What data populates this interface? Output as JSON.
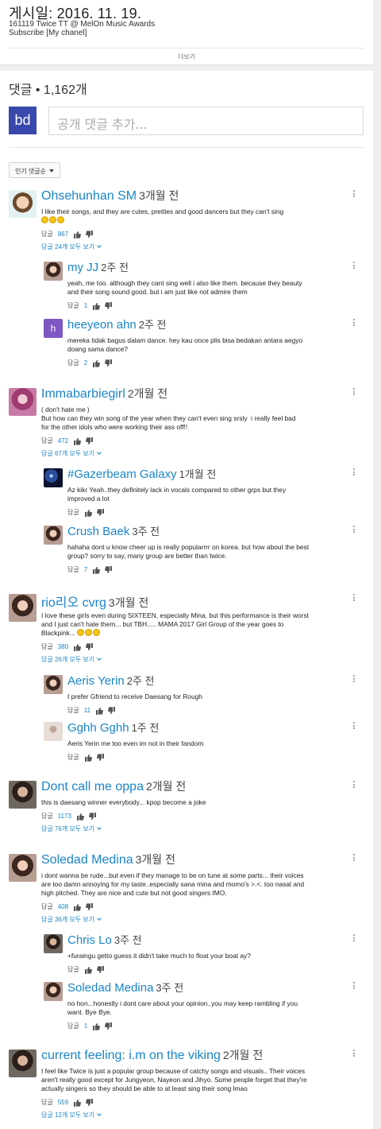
{
  "post": {
    "date_line": "게시일: 2016. 11. 19.",
    "desc_line1": "161119 Twice TT @ MelOn Music Awards",
    "desc_line2": "Subscribe [My chanel]",
    "more_label": "더보기"
  },
  "comments_section": {
    "count_label": "댓글 • 1,162개",
    "my_avatar_initials": "bd",
    "add_placeholder": "공개 댓글 추가...",
    "sort_label": "인기 댓글순"
  },
  "colors": {
    "link_blue": "#1a85c9",
    "my_avatar_bg": "#3949ab"
  },
  "comments": [
    {
      "author": "Ohsehunhan SM",
      "age": "3개월 전",
      "avatar": "cartoon-face-avatar",
      "text": "I like their songs, and they are cutes, pretties and good dancers but they can't sing\n",
      "emoji_count": 3,
      "reply_label": "답글",
      "likes": "867",
      "replies_toggle": "답글 24개 모두 보기"
    },
    {
      "author": "my JJ",
      "age": "2주 전",
      "avatar": "girl-photo-avatar",
      "text": "yeah, me too. although they cant sing well i also like them. because they beauty\nand their song sound good. but i am just like not admire them",
      "reply_label": "답글",
      "likes": "1"
    },
    {
      "author": "heeyeon ahn",
      "age": "2주 전",
      "avatar": "letter-h-avatar",
      "avatar_letter": "h",
      "text": "mereka tidak bagus dalam dance. hey kau once plis bisa bedakan antara aegyo\ndoang sama dance?",
      "reply_label": "답글",
      "likes": "2"
    },
    {
      "author": "Immabarbiegirl",
      "age": "2개월 전",
      "avatar": "pink-photo-avatar",
      "text": "( don't hate me )\nBut how can they win song of the year when they can't even sing srsly  i really feel bad\nfor the other idols who were working their ass off!!",
      "reply_label": "답글",
      "likes": "472",
      "replies_toggle": "답글 67개 모두 보기"
    },
    {
      "author": "#Gazerbeam Galaxy",
      "age": "1개월 전",
      "avatar": "galaxy-avatar",
      "text": "Az kikr Yeah..they definitely lack in vocals compared to other grps but they\nimproved a lot",
      "reply_label": "답글",
      "likes": ""
    },
    {
      "author": "Crush Baek",
      "age": "3주 전",
      "avatar": "girl-photo-avatar",
      "text": "hahaha dont u know cheer up is really popularrrr on korea. but how about the best\ngroup? sorry to say, many group are better than twice.",
      "reply_label": "답글",
      "likes": "7"
    },
    {
      "author": "rio리오 cvrg",
      "age": "3개월 전",
      "avatar": "girl-photo-avatar",
      "text": "I love these girls even during SIXTEEN, especially Mina, but this performance is their worst\nand I just can't hate them... but TBH..... MAMA 2017 Girl Group of the year goes to\nBlackpink... ",
      "emoji_count": 3,
      "reply_label": "답글",
      "likes": "380",
      "replies_toggle": "답글 26개 모두 보기"
    },
    {
      "author": "Aeris Yerin",
      "age": "2주 전",
      "avatar": "girl-photo-avatar",
      "text": "I prefer Gfriend to receive Daesang for Rough",
      "reply_label": "답글",
      "likes": "11"
    },
    {
      "author": "Gghh Gghh",
      "age": "1주 전",
      "avatar": "default-person-avatar",
      "text": "Aeris Yerin me too even im not in their fandom",
      "reply_label": "답글",
      "likes": ""
    },
    {
      "author": "Dont call me oppa",
      "age": "2개월 전",
      "avatar": "man-photo-avatar",
      "text": "this is daesang winner everybody... kpop become a joke",
      "reply_label": "답글",
      "likes": "1173",
      "replies_toggle": "답글 76개 모두 보기"
    },
    {
      "author": "Soledad Medina",
      "age": "3개월 전",
      "avatar": "girl-photo-avatar",
      "text": "i dont wanna be rude...but even if they manage to be on tune at some parts... their voices\nare too damn annoying for my taste..especially sana mina and momo's >.<. too nasal and\nhigh pitched. They are nice and cute but not good singers IMO.",
      "reply_label": "답글",
      "likes": "408",
      "replies_toggle": "답글 36개 모두 보기"
    },
    {
      "author": "Chris Lo",
      "age": "3주 전",
      "avatar": "man-photo-avatar",
      "text": "+furaingu getto guess it didn't take much to float your boat ay?",
      "reply_label": "답글",
      "likes": ""
    },
    {
      "author": "Soledad Medina",
      "age": "3주 전",
      "avatar": "girl-photo-avatar",
      "text": "no hon...honestly i dont care about your opinion..you may keep rambling if you\nwant. Bye Bye.",
      "reply_label": "답글",
      "likes": "1"
    },
    {
      "author": "current feeling: i.m on the viking",
      "age": "2개월 전",
      "avatar": "man-photo-avatar",
      "text": "I feel like Twice is just a popular group because of catchy songs and visuals.. Their voices\naren't really good except for Jungyeon, Nayeon and Jihyo. Some people forget that they're\nactually singers so they should be able to at least sing their song lmao",
      "reply_label": "답글",
      "likes": "559",
      "replies_toggle": "답글 12개 모두 보기"
    }
  ]
}
